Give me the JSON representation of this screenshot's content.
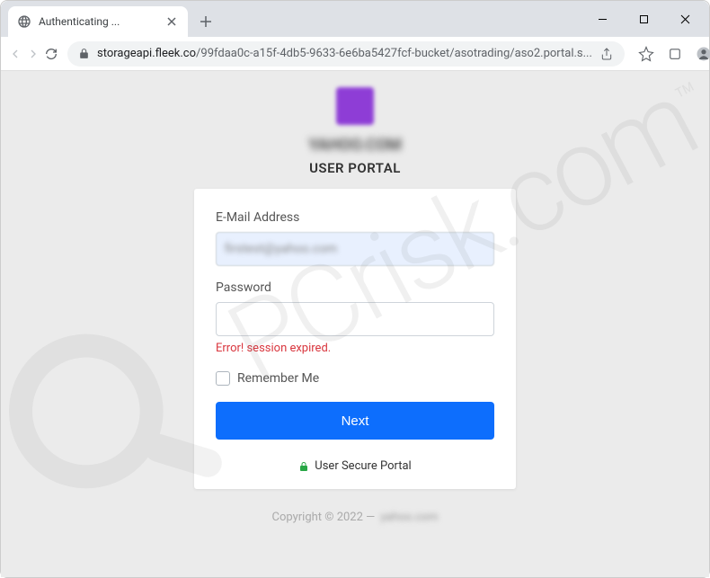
{
  "browser": {
    "tab_title": "Authenticating ...",
    "url_domain": "storageapi.fleek.co",
    "url_path": "/99fdaa0c-a15f-4db5-9633-6e6ba5427fcf-bucket/asotrading/aso2.portal.s..."
  },
  "page": {
    "org_name": "YAHOO.COM",
    "portal_title": "USER PORTAL",
    "email_label": "E-Mail Address",
    "email_value": "firstest@yahoo.com",
    "password_label": "Password",
    "password_value": "",
    "error_message": "Error! session expired.",
    "remember_label": "Remember Me",
    "next_label": "Next",
    "secure_label": "User Secure Portal",
    "copyright_prefix": "Copyright © 2022 —",
    "copyright_owner": "yahoo.com"
  },
  "watermark": {
    "text": "PCrisk.com"
  }
}
